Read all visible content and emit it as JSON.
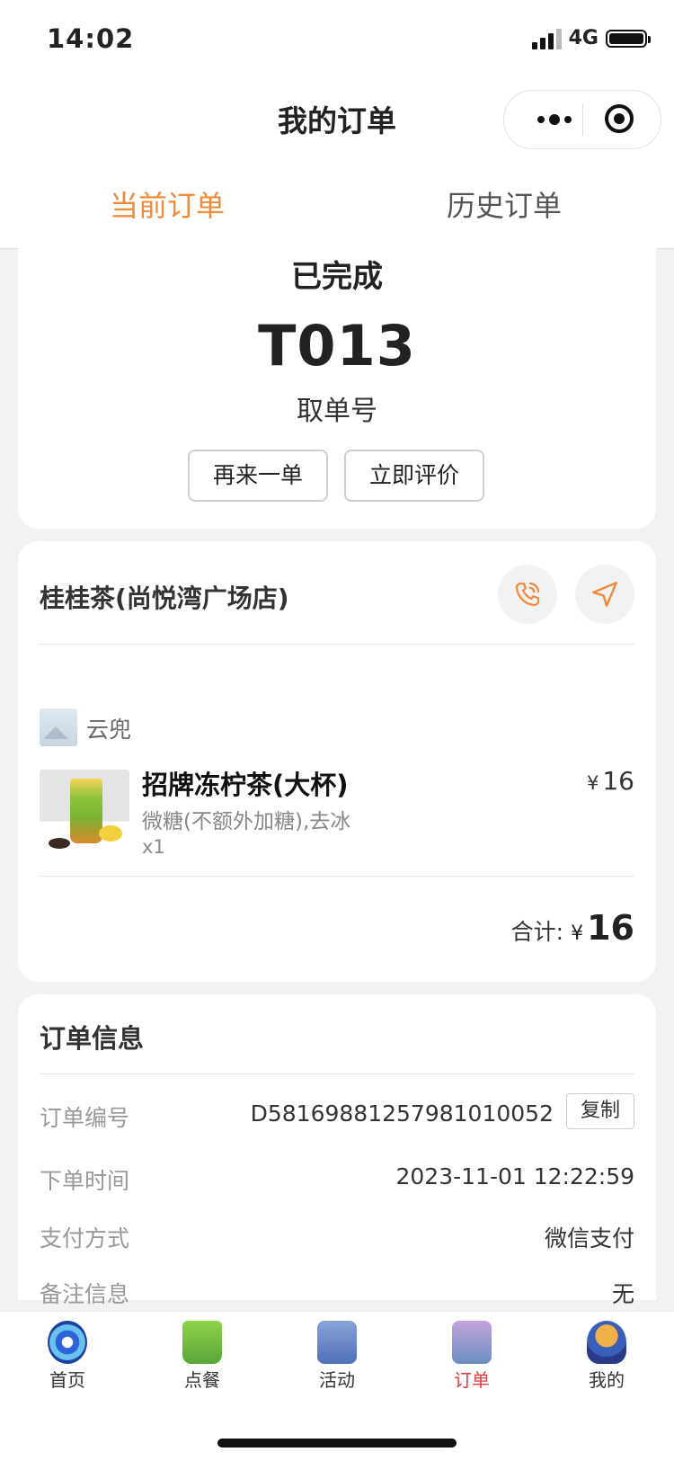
{
  "status_bar": {
    "time": "14:02",
    "network": "4G"
  },
  "nav": {
    "title": "我的订单"
  },
  "tabs": {
    "current": "当前订单",
    "history": "历史订单"
  },
  "order_status": {
    "status": "已完成",
    "pickup_number": "T013",
    "pickup_label": "取单号",
    "reorder_button": "再来一单",
    "review_button": "立即评价"
  },
  "store": {
    "name": "桂桂茶(尚悦湾广场店)",
    "shop_label": "云兜",
    "item": {
      "name": "招牌冻柠茶(大杯)",
      "spec": "微糖(不额外加糖),去冰",
      "qty": "x1",
      "currency": "¥",
      "price": "16"
    },
    "total_label": "合计:",
    "total_currency": "¥",
    "total_value": "16"
  },
  "order_info": {
    "title": "订单信息",
    "rows": [
      {
        "label": "订单编号",
        "value": "D58169881257981010052"
      },
      {
        "label": "下单时间",
        "value": "2023-11-01 12:22:59"
      },
      {
        "label": "支付方式",
        "value": "微信支付"
      },
      {
        "label": "备注信息",
        "value": "无"
      }
    ],
    "copy_button": "复制"
  },
  "tabbar": {
    "items": [
      {
        "label": "首页",
        "icon": "home-icon"
      },
      {
        "label": "点餐",
        "icon": "drink-cup-icon"
      },
      {
        "label": "活动",
        "icon": "activity-icon"
      },
      {
        "label": "订单",
        "icon": "orders-icon"
      },
      {
        "label": "我的",
        "icon": "profile-icon"
      }
    ],
    "active_index": 3
  },
  "colors": {
    "accent": "#f08a3c",
    "tab_active": "#e23d3d"
  }
}
